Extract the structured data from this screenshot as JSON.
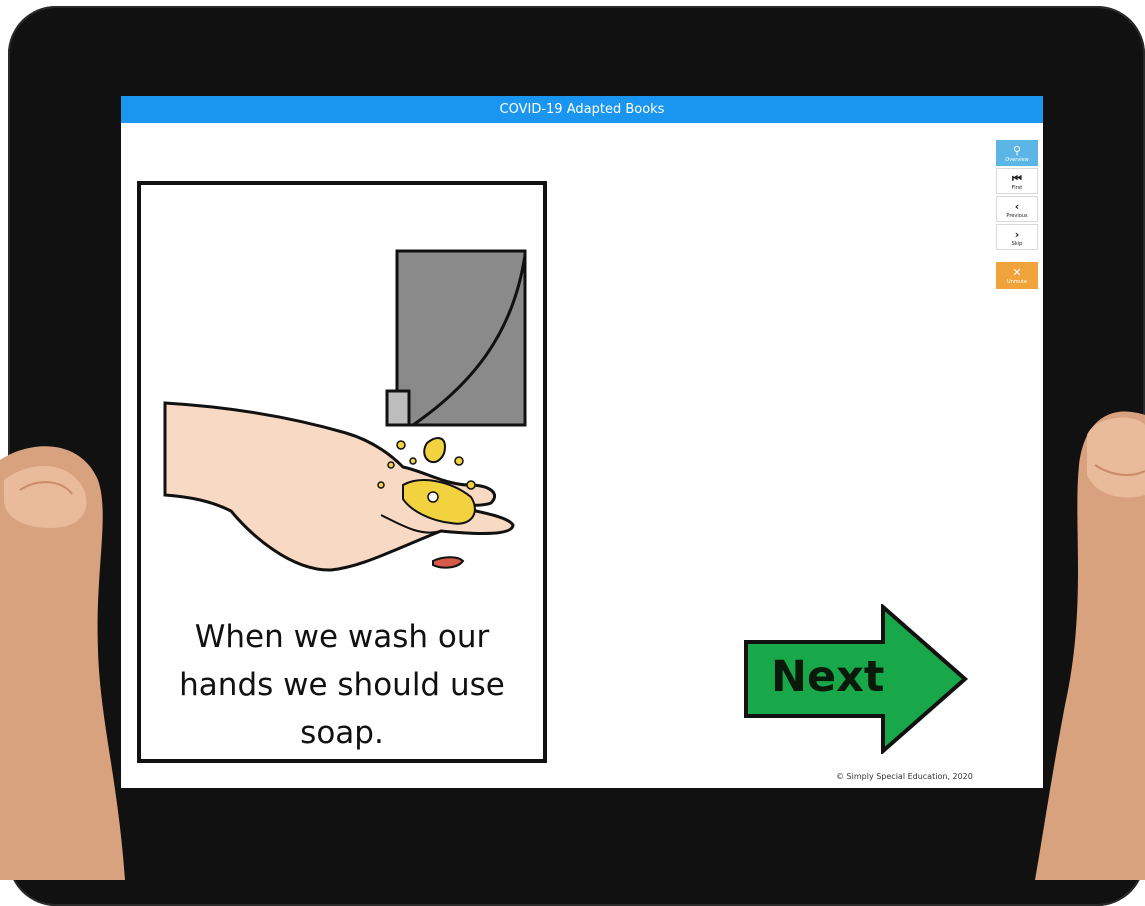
{
  "app": {
    "title": "COVID-19 Adapted Books"
  },
  "page": {
    "sentence": "When we wash our hands we should use soap."
  },
  "navigation": {
    "next_label": "Next"
  },
  "toolbar": {
    "buttons": [
      {
        "icon": "search-icon",
        "glyph": "🔍",
        "label": "Overview"
      },
      {
        "icon": "first-page-icon",
        "glyph": "⏮",
        "label": "First"
      },
      {
        "icon": "chevron-left-icon",
        "glyph": "‹",
        "label": "Previous"
      },
      {
        "icon": "chevron-right-icon",
        "glyph": "›",
        "label": "Skip"
      },
      {
        "icon": "close-icon",
        "glyph": "✕",
        "label": "Unmute"
      }
    ]
  },
  "footer": {
    "copyright": "© Simply Special Education, 2020"
  },
  "colors": {
    "titlebar": "#1a96f0",
    "next_arrow": "#18a84a",
    "search_button": "#5bb6e6",
    "unmute_button": "#f0a23b",
    "tablet_bezel": "#111111"
  }
}
